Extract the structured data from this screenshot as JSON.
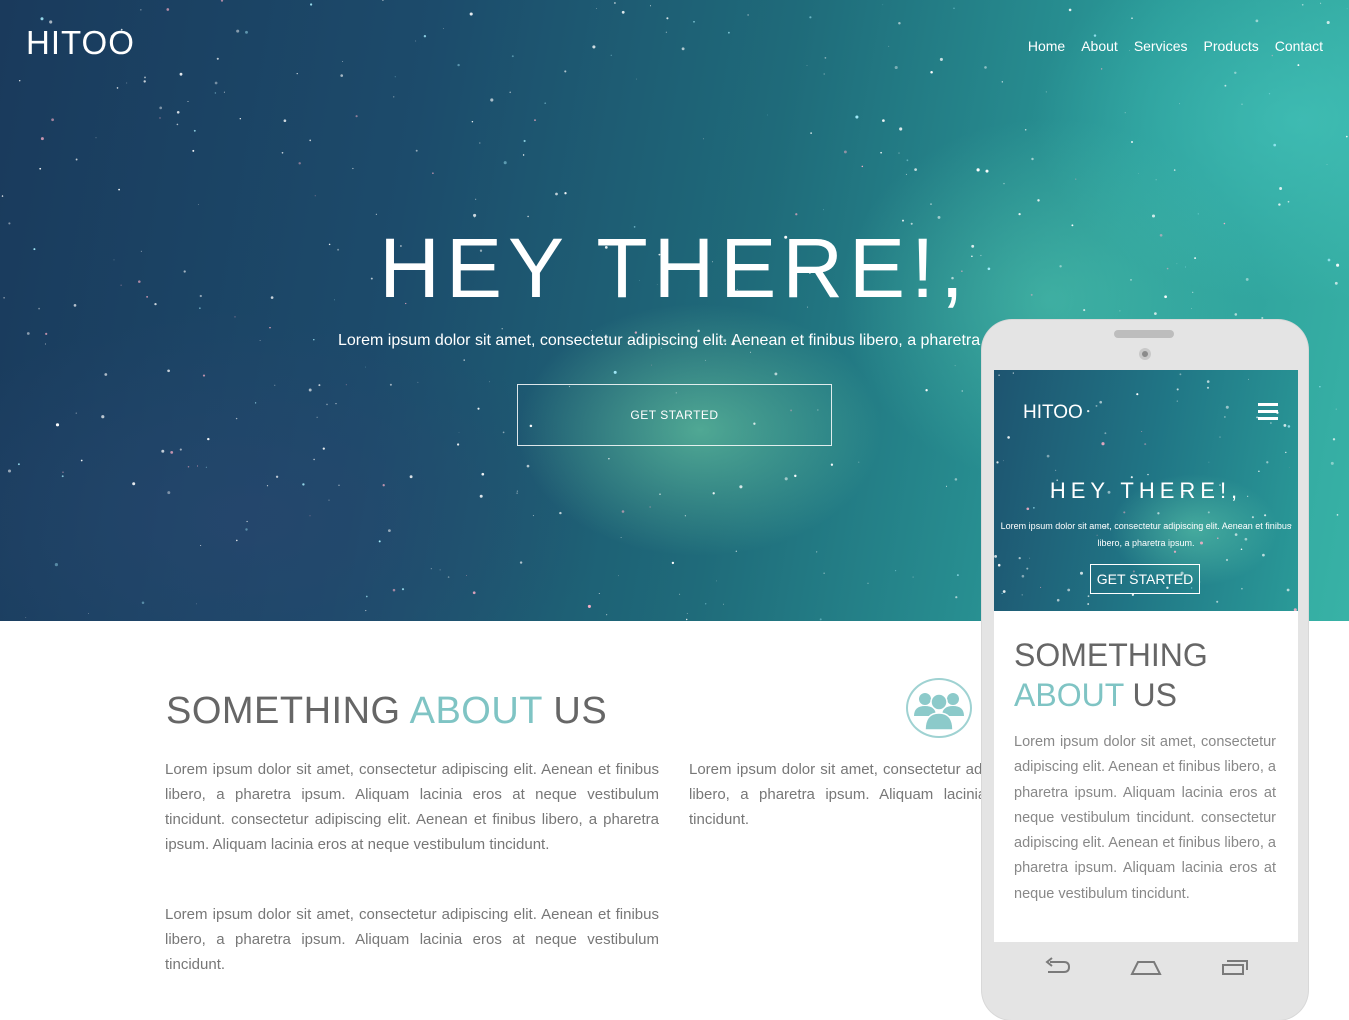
{
  "header": {
    "brand": "HITOO",
    "nav": [
      {
        "label": "Home"
      },
      {
        "label": "About"
      },
      {
        "label": "Services"
      },
      {
        "label": "Products"
      },
      {
        "label": "Contact"
      }
    ]
  },
  "hero": {
    "title": "HEY THERE!,",
    "subtitle": "Lorem ipsum dolor sit amet, consectetur adipiscing elit. Aenean et finibus libero, a pharetra ipsum.",
    "button": "GET STARTED"
  },
  "about": {
    "title_part1": "SOMETHING",
    "title_accent": "ABOUT",
    "title_part2": "US",
    "paragraph1": "Lorem ipsum dolor sit amet, consectetur adipiscing elit. Aenean et finibus libero, a pharetra ipsum. Aliquam lacinia eros at neque vestibulum tincidunt. consectetur adipiscing elit. Aenean et finibus libero, a pharetra ipsum. Aliquam lacinia eros at neque vestibulum tincidunt.",
    "paragraph2": "Lorem ipsum dolor sit amet, consectetur adipiscing elit. Aenean et finibus libero, a pharetra ipsum. Aliquam lacinia eros at neque vestibulum tincidunt.",
    "paragraph3": "Lorem ipsum dolor sit amet, consectetur adipiscing elit. Aenean et finibus libero, a pharetra ipsum. Aliquam lacinia eros at neque vestibulum tincidunt.",
    "icon": "users-icon"
  },
  "phone": {
    "brand": "HITOO",
    "menu_icon": "hamburger-menu-icon",
    "hero_title": "HEY THERE!,",
    "hero_subtitle": "Lorem ipsum dolor sit amet, consectetur adipiscing elit. Aenean et finibus libero, a pharetra ipsum.",
    "hero_button": "GET STARTED",
    "about_part1": "SOMETHING",
    "about_accent": "ABOUT",
    "about_part2": "US",
    "about_text": "Lorem ipsum dolor sit amet, consectetur adipiscing elit. Aenean et finibus libero, a pharetra ipsum. Aliquam lacinia eros at neque vestibulum tincidunt. consectetur adipiscing elit. Aenean et finibus libero, a pharetra ipsum. Aliquam lacinia eros at neque vestibulum tincidunt.",
    "nav_icons": [
      "back-icon",
      "home-icon",
      "recent-apps-icon"
    ]
  },
  "colors": {
    "accent": "#7fc4c4",
    "heading": "#666666",
    "body_text": "#777777",
    "phone_frame": "#e4e4e4"
  }
}
